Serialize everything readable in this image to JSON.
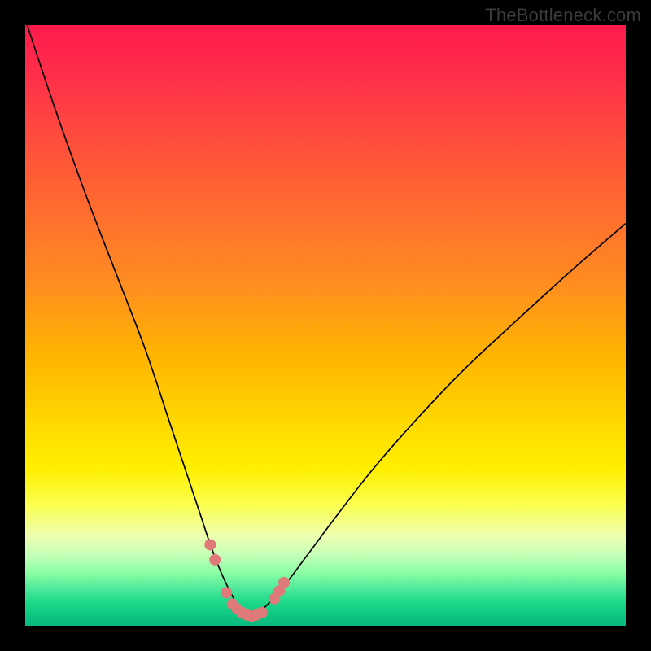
{
  "watermark": "TheBottleneck.com",
  "colors": {
    "background_frame": "#000000",
    "curve_stroke": "#000000",
    "dot_fill": "#e07a7a",
    "gradient_top": "#ff1a4d",
    "gradient_bottom": "#0ab87d"
  },
  "chart_data": {
    "type": "line",
    "title": "",
    "xlabel": "",
    "ylabel": "",
    "xlim": [
      0,
      100
    ],
    "ylim": [
      0,
      100
    ],
    "grid": false,
    "legend": false,
    "x": [
      0,
      5,
      10,
      15,
      20,
      24,
      27,
      29,
      31,
      33,
      35,
      36,
      37,
      38,
      40,
      43,
      47,
      52,
      58,
      65,
      73,
      82,
      91,
      100
    ],
    "series": [
      {
        "name": "bottleneck-curve",
        "values": [
          101,
          86,
          72,
          59,
          46,
          34,
          25,
          19,
          13,
          8,
          4,
          2.2,
          1.5,
          1.8,
          3.2,
          6.5,
          11.8,
          18.5,
          26.2,
          34.2,
          42.6,
          51.0,
          59.2,
          67.0
        ]
      }
    ],
    "markers": {
      "name": "highlighted-points",
      "x": [
        30.8,
        31.6,
        33.5,
        34.5,
        35.3,
        36.1,
        36.9,
        37.7,
        38.5,
        39.4,
        41.5,
        42.3,
        43.1
      ],
      "y": [
        13.5,
        11.0,
        5.5,
        3.6,
        2.8,
        2.2,
        1.8,
        1.6,
        1.8,
        2.2,
        4.5,
        5.8,
        7.2
      ],
      "radius": 7
    }
  }
}
